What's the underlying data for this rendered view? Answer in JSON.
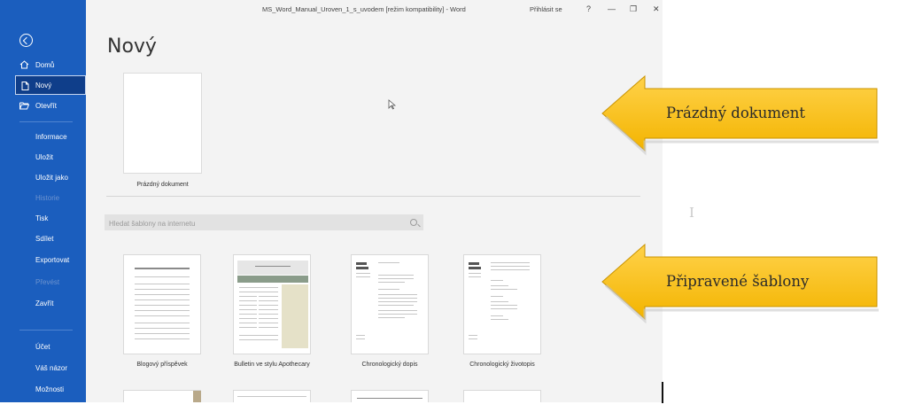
{
  "window": {
    "title": "MS_Word_Manual_Uroven_1_s_uvodem [režim kompatibility]  -  Word",
    "sign_in": "Přihlásit se",
    "help": "?",
    "minimize": "—",
    "restore": "❐",
    "close": "✕"
  },
  "sidebar": {
    "items": [
      {
        "label": "Domů",
        "icon": "home-icon"
      },
      {
        "label": "Nový",
        "icon": "new-document-icon",
        "active": true
      },
      {
        "label": "Otevřít",
        "icon": "open-folder-icon"
      },
      {
        "label": "Informace"
      },
      {
        "label": "Uložit"
      },
      {
        "label": "Uložit jako"
      },
      {
        "label": "Historie",
        "disabled": true
      },
      {
        "label": "Tisk"
      },
      {
        "label": "Sdílet"
      },
      {
        "label": "Exportovat"
      },
      {
        "label": "Převést",
        "disabled": true
      },
      {
        "label": "Zavřít"
      },
      {
        "label": "Účet"
      },
      {
        "label": "Váš názor"
      },
      {
        "label": "Možnosti"
      }
    ]
  },
  "main": {
    "title": "Nový",
    "blank_document_label": "Prázdný dokument",
    "search_placeholder": "Hledat šablony na internetu",
    "templates": [
      {
        "label": "Blogový příspěvek"
      },
      {
        "label": "Bulletin ve stylu Apothecary"
      },
      {
        "label": "Chronologický dopis"
      },
      {
        "label": "Chronologický životopis"
      }
    ]
  },
  "callouts": {
    "blank": "Prázdný dokument",
    "templates": "Připravené šablony",
    "fill_color": "#ffc21a",
    "box_color": "#ffc91f"
  },
  "colors": {
    "sidebar": "#1b5ebe",
    "active_item": "#0f3e8a",
    "background": "#f3f3f3"
  }
}
